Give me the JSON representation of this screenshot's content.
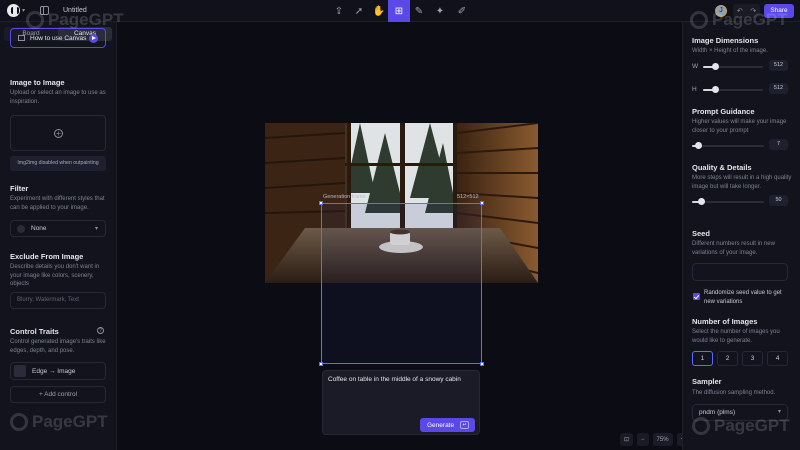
{
  "header": {
    "doc_title": "Untitled",
    "share_label": "Share",
    "avatar_initial": "J",
    "tools": [
      "upload-tool-icon",
      "select-tool-icon",
      "hand-tool-icon",
      "generate-frame-icon",
      "brush-tool-icon",
      "fill-tool-icon",
      "pen-tool-icon"
    ],
    "active_tool": "generate-frame-icon"
  },
  "left_panel": {
    "tabs": [
      "Board",
      "Canvas"
    ],
    "active_tab": "Canvas",
    "how_to_label": "How to use Canvas",
    "image_to_image": {
      "title": "Image to Image",
      "desc": "Upload or select an image to use as inspiration.",
      "chip": "Img2img disabled when outpainting"
    },
    "filter": {
      "title": "Filter",
      "desc": "Experiment with different styles that can be applied to your image.",
      "value": "None"
    },
    "exclude": {
      "title": "Exclude From Image",
      "desc": "Describe details you don't want in your image like colors, scenery, objects",
      "placeholder": "Blurry, Watermark, Text"
    },
    "control_traits": {
      "title": "Control Traits",
      "desc": "Control generated image's traits like edges, depth, and pose.",
      "item": "Edge → Image",
      "add_label": "+ Add control"
    }
  },
  "canvas": {
    "frame_label": "Generation frame",
    "frame_size": "512×512",
    "prompt": "Coffee on table in the middle of a snowy cabin",
    "generate_label": "Generate",
    "zoom": "75%"
  },
  "right_panel": {
    "dimensions": {
      "title": "Image Dimensions",
      "desc": "Width × Height of the image.",
      "w_label": "W",
      "w_value": "512",
      "w_fraction": 0.2,
      "h_label": "H",
      "h_value": "512",
      "h_fraction": 0.2
    },
    "guidance": {
      "title": "Prompt Guidance",
      "desc": "Higher values will make your image closer to your prompt",
      "value": "7",
      "fraction": 0.09
    },
    "quality": {
      "title": "Quality & Details",
      "desc": "More steps will result in a high quality image but will take longer.",
      "value": "50",
      "fraction": 0.13
    },
    "seed": {
      "title": "Seed",
      "desc": "Different numbers result in new variations of your image.",
      "randomize_label": "Randomize seed value to get new variations"
    },
    "num_images": {
      "title": "Number of Images",
      "desc": "Select the number of images you would like to generate.",
      "options": [
        "1",
        "2",
        "3",
        "4"
      ],
      "selected": "1"
    },
    "sampler": {
      "title": "Sampler",
      "desc": "The diffusion sampling method.",
      "value": "pndm (plms)"
    }
  },
  "watermark_text": "PageGPT"
}
